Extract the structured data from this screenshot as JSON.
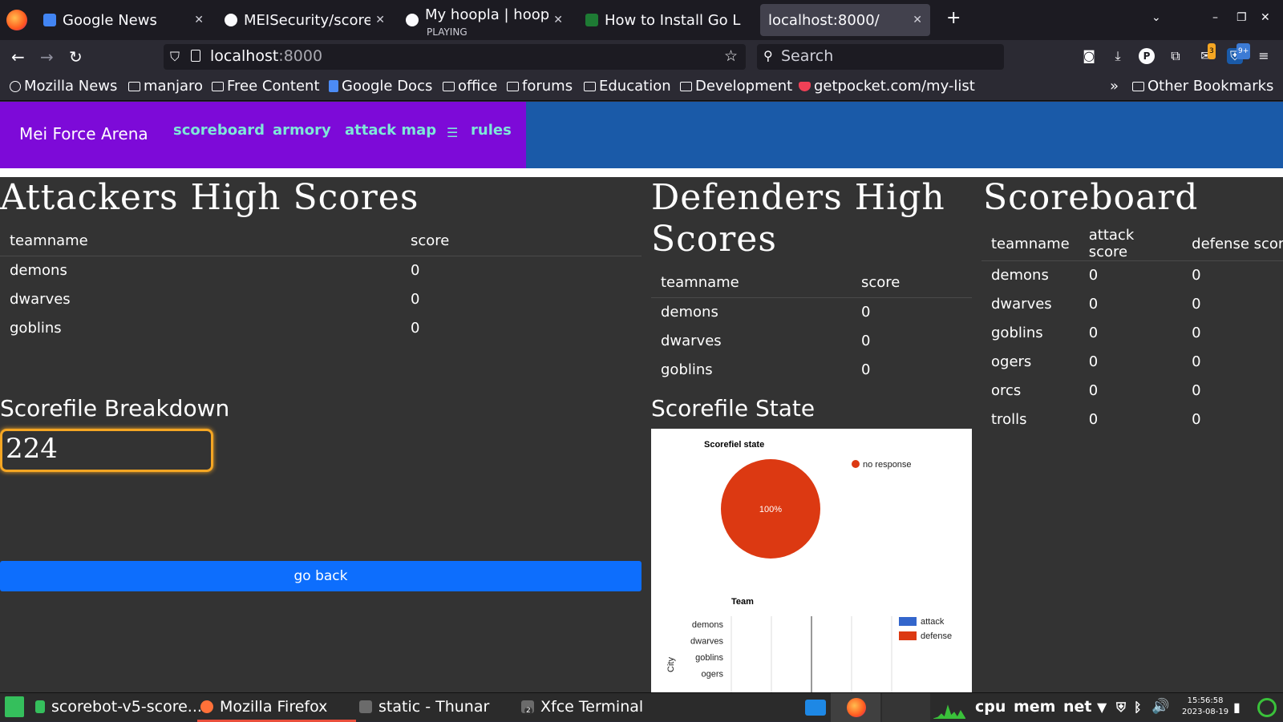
{
  "browser": {
    "tabs": [
      {
        "title": "Google News",
        "subtitle": "",
        "favicon_color": "#4285f4"
      },
      {
        "title": "MEISecurity/scoreb",
        "subtitle": "",
        "favicon_color": "#fbfbfe"
      },
      {
        "title": "My hoopla | hoopl",
        "subtitle": "PLAYING",
        "favicon_color": "#fbfbfe"
      },
      {
        "title": "How to Install Go L",
        "subtitle": "",
        "favicon_color": "#1e7b34"
      },
      {
        "title": "localhost:8000/",
        "subtitle": "",
        "favicon_color": ""
      }
    ],
    "url": {
      "host": "localhost",
      "port": ":8000"
    },
    "search_placeholder": "Search",
    "bookmarks": [
      "Mozilla News",
      "manjaro",
      "Free Content",
      "Google Docs",
      "office",
      "forums",
      "Education",
      "Development",
      "getpocket.com/my-list"
    ],
    "other_bookmarks": "Other Bookmarks",
    "extension_badge_1": "3",
    "extension_badge_2": "9+"
  },
  "nav": {
    "brand": "Mei Force Arena",
    "links": [
      "scoreboard",
      "armory",
      "attack map",
      "rules"
    ],
    "brand_bg": "#7d0ad8",
    "bar_bg": "#1a5aa8",
    "link_color": "#7ee7d8"
  },
  "attackers": {
    "heading": "Attackers High Scores",
    "columns": [
      "teamname",
      "score"
    ],
    "rows": [
      [
        "demons",
        "0"
      ],
      [
        "dwarves",
        "0"
      ],
      [
        "goblins",
        "0"
      ]
    ]
  },
  "defenders": {
    "heading_line1": "Defenders High",
    "heading_line2": "Scores",
    "columns": [
      "teamname",
      "score"
    ],
    "rows": [
      [
        "demons",
        "0"
      ],
      [
        "dwarves",
        "0"
      ],
      [
        "goblins",
        "0"
      ]
    ]
  },
  "scoreboard": {
    "heading": "Scoreboard",
    "columns": [
      "teamname",
      "attack score",
      "defense score"
    ],
    "rows": [
      [
        "demons",
        "0",
        "0"
      ],
      [
        "dwarves",
        "0",
        "0"
      ],
      [
        "goblins",
        "0",
        "0"
      ],
      [
        "ogers",
        "0",
        "0"
      ],
      [
        "orcs",
        "0",
        "0"
      ],
      [
        "trolls",
        "0",
        "0"
      ]
    ]
  },
  "scorefile_breakdown": {
    "heading": "Scorefile Breakdown",
    "value": "224",
    "go_back": "go back"
  },
  "scorefile_state": {
    "heading": "Scorefile State"
  },
  "chart_data": [
    {
      "type": "pie",
      "title": "Scorefiel state",
      "slices": [
        {
          "label": "no response",
          "value": 100,
          "color": "#dc3912"
        }
      ],
      "data_label": "100%",
      "legend_placement": "top-right"
    },
    {
      "type": "bar",
      "orientation": "horizontal",
      "title": "Team",
      "ylabel": "City",
      "categories": [
        "demons",
        "dwarves",
        "goblins",
        "ogers"
      ],
      "series": [
        {
          "name": "attack",
          "values": [
            0,
            0,
            0,
            0
          ],
          "color": "#3366cc"
        },
        {
          "name": "defense",
          "values": [
            0,
            0,
            0,
            0
          ],
          "color": "#dc3912"
        }
      ],
      "legend_placement": "right"
    }
  ],
  "taskbar": {
    "items": [
      "scorebot-v5-score...",
      "Mozilla Firefox",
      "static - Thunar",
      "Xfce Terminal"
    ],
    "monitors": [
      "cpu",
      "mem",
      "net"
    ],
    "time": "15:56:58",
    "date": "2023-08-19",
    "terminal_badge": "2"
  }
}
